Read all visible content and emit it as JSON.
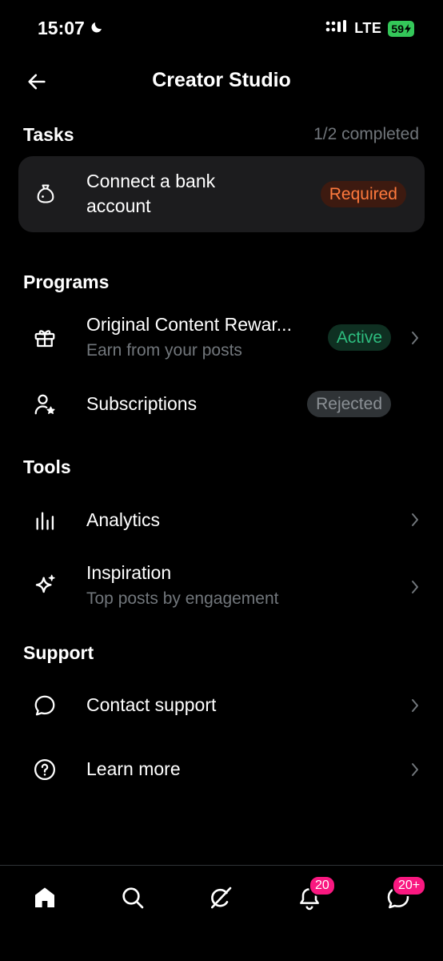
{
  "status_bar": {
    "time": "15:07",
    "network": "LTE",
    "battery": "59"
  },
  "header": {
    "title": "Creator Studio"
  },
  "tasks": {
    "title": "Tasks",
    "progress": "1/2 completed",
    "items": [
      {
        "label_line1": "Connect a bank",
        "label_line2": "account",
        "badge": "Required",
        "icon": "money-bag-icon"
      }
    ]
  },
  "programs": {
    "title": "Programs",
    "items": [
      {
        "label": "Original Content Rewar...",
        "subtitle": "Earn from your posts",
        "badge": "Active",
        "icon": "gift-icon"
      },
      {
        "label": "Subscriptions",
        "badge": "Rejected",
        "icon": "person-star-icon"
      }
    ]
  },
  "tools": {
    "title": "Tools",
    "items": [
      {
        "label": "Analytics",
        "icon": "analytics-icon"
      },
      {
        "label": "Inspiration",
        "subtitle": "Top posts by engagement",
        "icon": "sparkle-icon"
      }
    ]
  },
  "support": {
    "title": "Support",
    "items": [
      {
        "label": "Contact support",
        "icon": "chat-bubble-icon"
      },
      {
        "label": "Learn more",
        "icon": "help-circle-icon"
      }
    ]
  },
  "bottom_nav": {
    "items": [
      {
        "icon": "home-icon"
      },
      {
        "icon": "search-icon"
      },
      {
        "icon": "grok-icon"
      },
      {
        "icon": "bell-icon",
        "badge": "20"
      },
      {
        "icon": "messages-icon",
        "badge": "20+"
      }
    ]
  },
  "colors": {
    "background": "#000000",
    "card": "#1c1c1e",
    "secondary_text": "#71767b",
    "required": "#ff7a3d",
    "active": "#2ebd7f",
    "notification": "#f91880"
  }
}
